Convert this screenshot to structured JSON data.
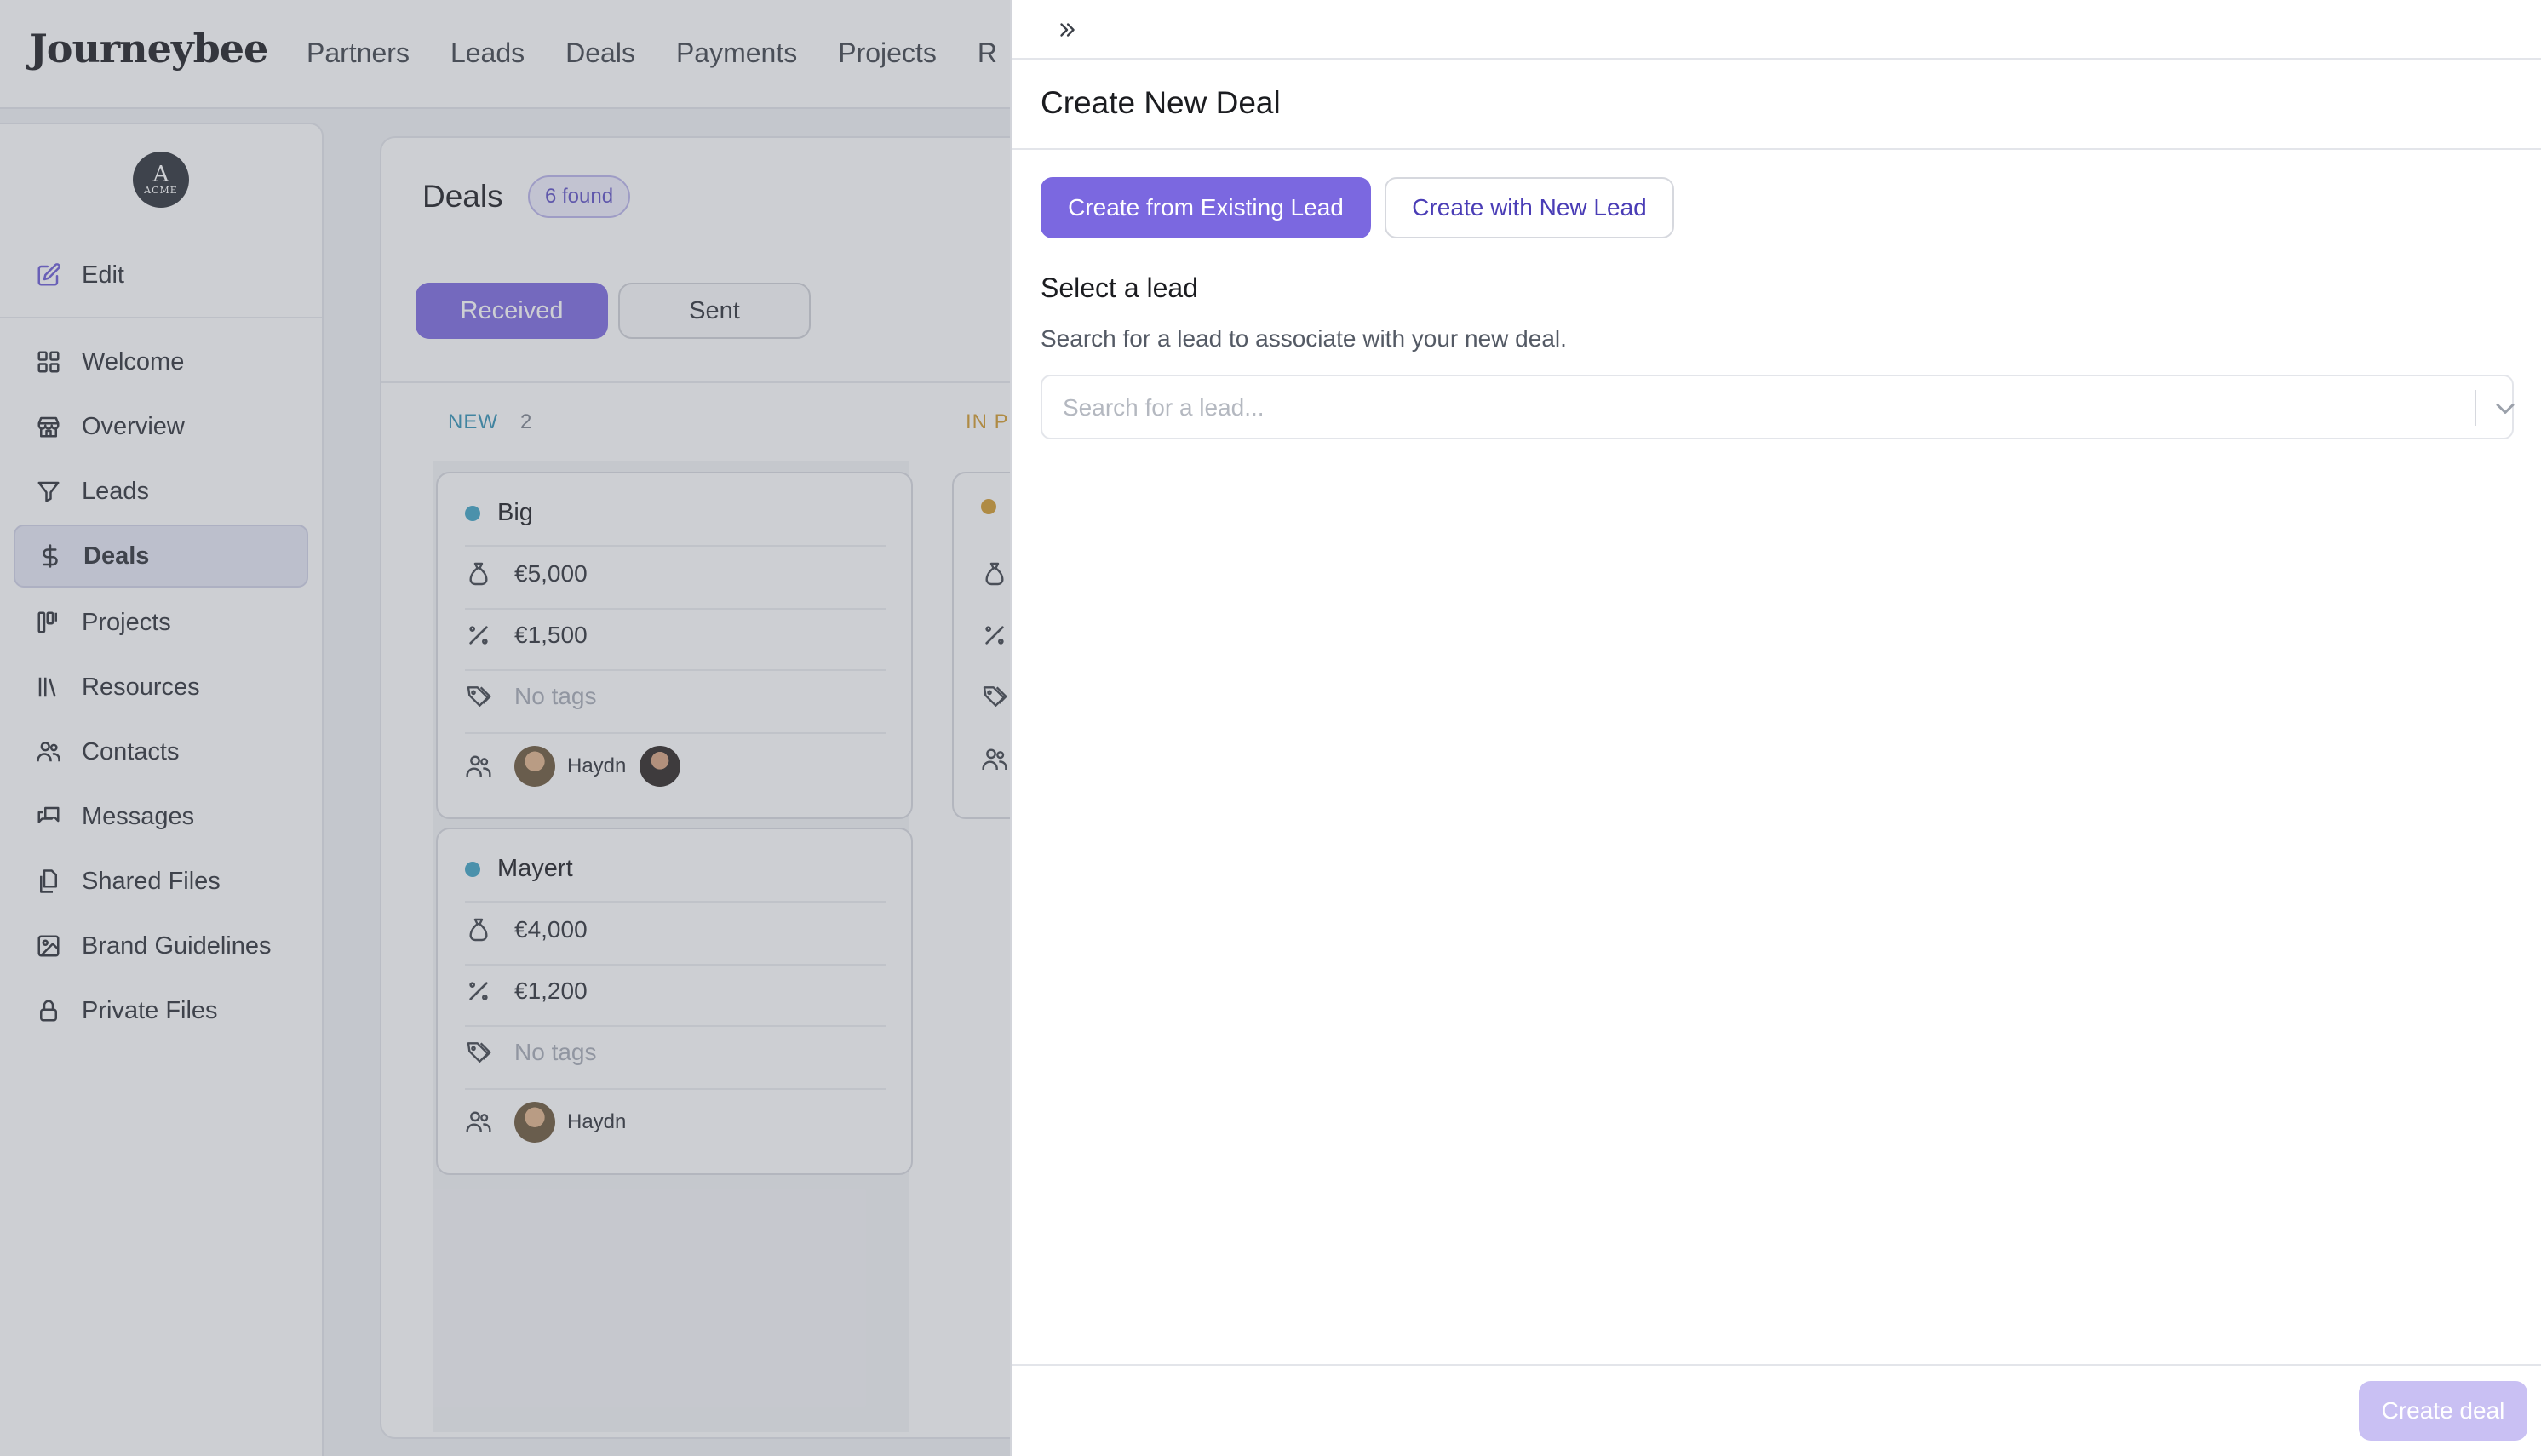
{
  "app": {
    "logo": "Journeybee",
    "nav": [
      "Partners",
      "Leads",
      "Deals",
      "Payments",
      "Projects",
      "R"
    ]
  },
  "sidebar": {
    "org_avatar": {
      "mark": "A",
      "word": "ACME"
    },
    "items": [
      {
        "label": "Edit",
        "icon": "edit-icon"
      },
      {
        "label": "Welcome",
        "icon": "grid-icon"
      },
      {
        "label": "Overview",
        "icon": "store-icon"
      },
      {
        "label": "Leads",
        "icon": "filter-icon"
      },
      {
        "label": "Deals",
        "icon": "dollar-icon",
        "active": true
      },
      {
        "label": "Projects",
        "icon": "kanban-icon"
      },
      {
        "label": "Resources",
        "icon": "library-icon"
      },
      {
        "label": "Contacts",
        "icon": "users-icon"
      },
      {
        "label": "Messages",
        "icon": "message-icon"
      },
      {
        "label": "Shared Files",
        "icon": "files-icon"
      },
      {
        "label": "Brand Guidelines",
        "icon": "image-icon"
      },
      {
        "label": "Private Files",
        "icon": "lock-icon"
      }
    ]
  },
  "deals": {
    "title": "Deals",
    "found": "6 found",
    "tabs": [
      "Received",
      "Sent"
    ],
    "columns": [
      {
        "label": "NEW",
        "count": "2",
        "color": "#2f8fb3"
      },
      {
        "label": "IN P",
        "color": "#d39a2a"
      }
    ],
    "cards": [
      {
        "name": "Big",
        "value": "€5,000",
        "commission": "€1,500",
        "tags": "No tags",
        "people": [
          "Haydn"
        ]
      },
      {
        "name": "Mayert",
        "value": "€4,000",
        "commission": "€1,200",
        "tags": "No tags",
        "people": [
          "Haydn"
        ]
      }
    ]
  },
  "drawer": {
    "title": "Create New Deal",
    "mode_buttons": [
      "Create from Existing Lead",
      "Create with New Lead"
    ],
    "select_heading": "Select a lead",
    "select_sub": "Search for a lead to associate with your new deal.",
    "search_placeholder": "Search for a lead...",
    "search_value": "",
    "submit": "Create deal"
  },
  "colors": {
    "accent": "#7b68e0",
    "accent_disabled": "#c9c0f3",
    "new_status": "#2f8fb3",
    "in_progress_status": "#d39a2a"
  }
}
